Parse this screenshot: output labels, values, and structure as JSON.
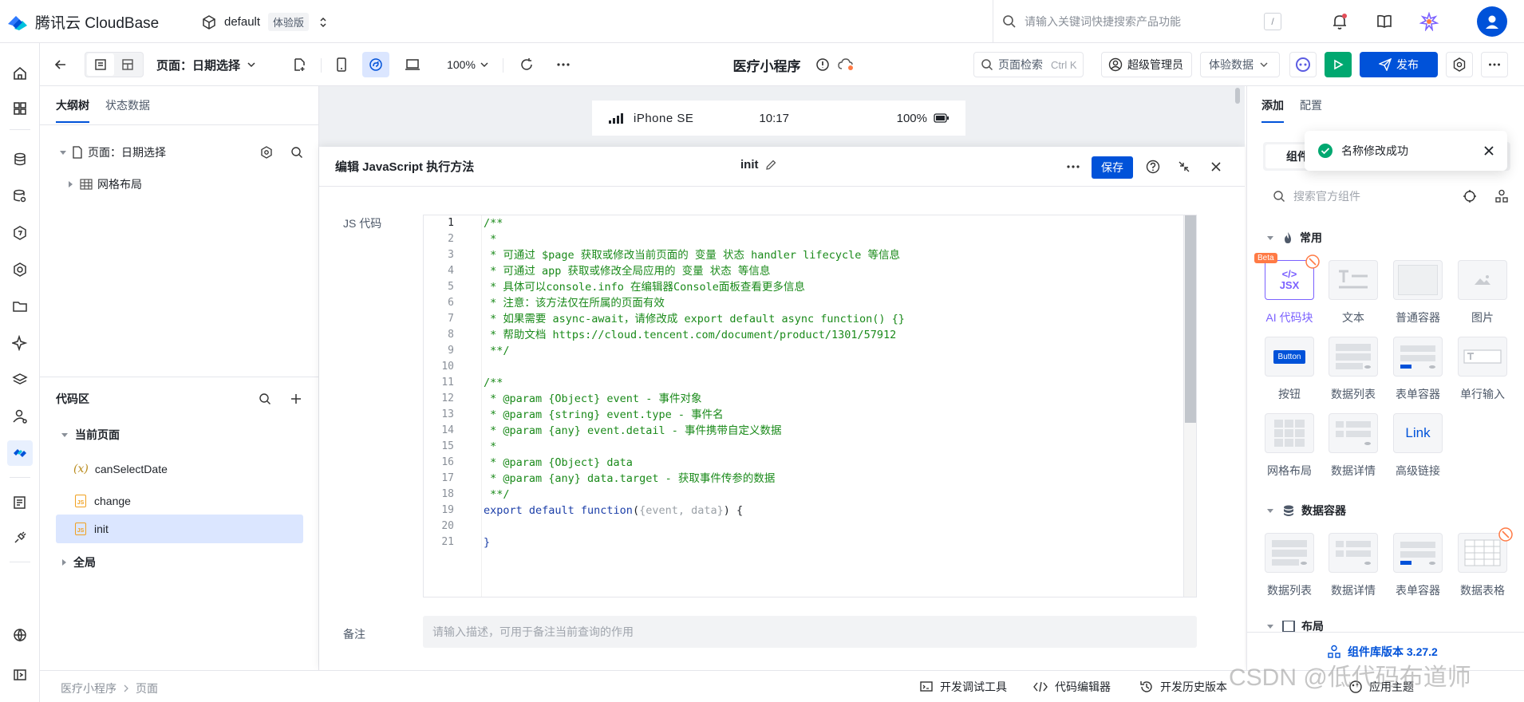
{
  "brand": {
    "name": "腾讯云 CloudBase",
    "env": "default",
    "env_badge": "体验版"
  },
  "search": {
    "placeholder": "请输入关键词快捷搜索产品功能",
    "shortcut": "/"
  },
  "toolbar": {
    "page_label": "页面：日期选择",
    "zoom": "100%",
    "app_title": "医疗小程序",
    "page_search": "页面检索",
    "page_search_shortcut": "Ctrl K",
    "role": "超级管理员",
    "data_mode": "体验数据",
    "publish": "发布"
  },
  "left_panel": {
    "tabs": [
      "大纲树",
      "状态数据"
    ],
    "tree": {
      "root": "页面：日期选择",
      "child": "网格布局"
    },
    "code_section": {
      "title": "代码区",
      "group": "当前页面",
      "items": [
        {
          "icon": "(x)",
          "label": "canSelectDate"
        },
        {
          "icon": "JS",
          "label": "change"
        },
        {
          "icon": "JS",
          "label": "init"
        }
      ],
      "global": "全局"
    }
  },
  "device": {
    "name": "iPhone SE",
    "time": "10:17",
    "battery": "100%"
  },
  "editor": {
    "title": "编辑 JavaScript 执行方法",
    "method_name": "init",
    "save": "保存",
    "code_label": "JS 代码",
    "note_label": "备注",
    "note_placeholder": "请输入描述，可用于备注当前查询的作用",
    "code_lines": [
      "/**",
      " *",
      " * 可通过 $page 获取或修改当前页面的 变量 状态 handler lifecycle 等信息",
      " * 可通过 app 获取或修改全局应用的 变量 状态 等信息",
      " * 具体可以console.info 在编辑器Console面板查看更多信息",
      " * 注意：该方法仅在所属的页面有效",
      " * 如果需要 async-await，请修改成 export default async function() {}",
      " * 帮助文档 https://cloud.tencent.com/document/product/1301/57912",
      " **/",
      "",
      "/**",
      " * @param {Object} event - 事件对象",
      " * @param {string} event.type - 事件名",
      " * @param {any} event.detail - 事件携带自定义数据",
      " *",
      " * @param {Object} data",
      " * @param {any} data.target - 获取事件传参的数据",
      " **/",
      "export default function({event, data}) {",
      "",
      "}"
    ],
    "line_numbers": [
      "1",
      "2",
      "3",
      "4",
      "5",
      "6",
      "7",
      "8",
      "9",
      "10",
      "11",
      "12",
      "13",
      "14",
      "15",
      "16",
      "17",
      "18",
      "19",
      "20",
      "21"
    ]
  },
  "right_panel": {
    "tabs": [
      "添加",
      "配置"
    ],
    "sub_tab": "组件",
    "search_placeholder": "搜索官方组件",
    "toast": "名称修改成功",
    "sections": [
      {
        "title": "常用",
        "items": [
          "AI 代码块",
          "文本",
          "普通容器",
          "图片",
          "按钮",
          "数据列表",
          "表单容器",
          "单行输入",
          "网格布局",
          "数据详情",
          "高级链接"
        ]
      },
      {
        "title": "数据容器",
        "items": [
          "数据列表",
          "数据详情",
          "表单容器",
          "数据表格"
        ]
      },
      {
        "title": "布局",
        "items": []
      }
    ],
    "thumb_text": {
      "jsx": "JSX",
      "beta": "Beta",
      "button": "Button",
      "link": "Link"
    },
    "version": "组件库版本 3.27.2",
    "apply_theme": "应用主题"
  },
  "footer": {
    "breadcrumb": [
      "医疗小程序",
      "页面"
    ],
    "tools": [
      "开发调试工具",
      "代码编辑器",
      "开发历史版本"
    ]
  },
  "watermark": "CSDN @低代码布道师",
  "colors": {
    "primary": "#0052d9",
    "green": "#00a870",
    "code_green": "#1a8a1a",
    "code_blue": "#1b3ea8"
  }
}
